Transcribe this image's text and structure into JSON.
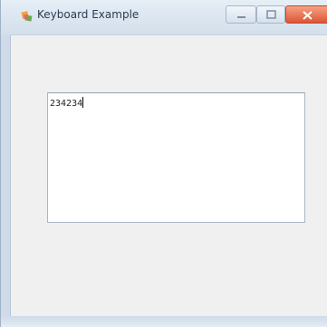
{
  "window": {
    "title": "Keyboard Example"
  },
  "controls": {
    "minimize_icon": "minimize-icon",
    "maximize_icon": "maximize-icon",
    "close_icon": "close-icon",
    "close_color": "#dd5534"
  },
  "textbox": {
    "value": "234234"
  },
  "colors": {
    "titlebar": "#d3dfeb",
    "client": "#f0f0f0",
    "textbox_border": "#a9b7c6"
  }
}
